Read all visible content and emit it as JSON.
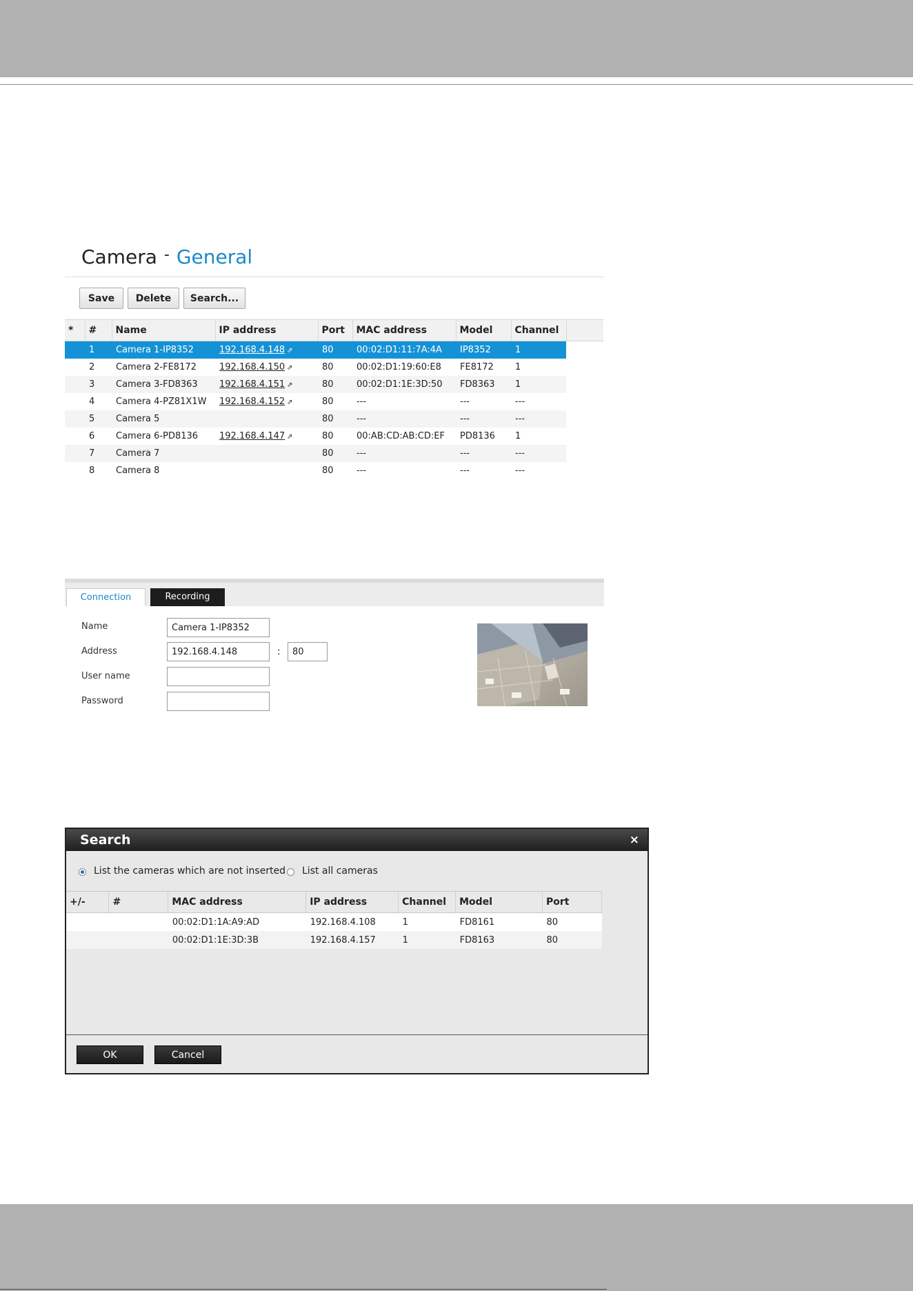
{
  "camera_page": {
    "title": "Camera",
    "separator": "-",
    "subtitle": "General",
    "toolbar": {
      "save_label": "Save",
      "delete_label": "Delete",
      "search_label": "Search..."
    },
    "columns": [
      "*",
      "#",
      "Name",
      "IP address",
      "Port",
      "MAC address",
      "Model",
      "Channel"
    ],
    "rows": [
      {
        "num": "1",
        "name": "Camera 1-IP8352",
        "ip": "192.168.4.148",
        "port": "80",
        "mac": "00:02:D1:11:7A:4A",
        "model": "IP8352",
        "channel": "1",
        "selected": true
      },
      {
        "num": "2",
        "name": "Camera 2-FE8172",
        "ip": "192.168.4.150",
        "port": "80",
        "mac": "00:02:D1:19:60:E8",
        "model": "FE8172",
        "channel": "1"
      },
      {
        "num": "3",
        "name": "Camera 3-FD8363",
        "ip": "192.168.4.151",
        "port": "80",
        "mac": "00:02:D1:1E:3D:50",
        "model": "FD8363",
        "channel": "1"
      },
      {
        "num": "4",
        "name": "Camera 4-PZ81X1W",
        "ip": "192.168.4.152",
        "port": "80",
        "mac": "---",
        "model": "---",
        "channel": "---"
      },
      {
        "num": "5",
        "name": "Camera 5",
        "ip": "",
        "port": "80",
        "mac": "---",
        "model": "---",
        "channel": "---"
      },
      {
        "num": "6",
        "name": "Camera 6-PD8136",
        "ip": "192.168.4.147",
        "port": "80",
        "mac": "00:AB:CD:AB:CD:EF",
        "model": "PD8136",
        "channel": "1"
      },
      {
        "num": "7",
        "name": "Camera 7",
        "ip": "",
        "port": "80",
        "mac": "---",
        "model": "---",
        "channel": "---"
      },
      {
        "num": "8",
        "name": "Camera 8",
        "ip": "",
        "port": "80",
        "mac": "---",
        "model": "---",
        "channel": "---"
      }
    ]
  },
  "tabs": {
    "connection_label": "Connection",
    "recording_label": "Recording"
  },
  "connection_form": {
    "name_label": "Name",
    "name_value": "Camera 1-IP8352",
    "address_label": "Address",
    "address_value": "192.168.4.148",
    "port_separator": ":",
    "port_value": "80",
    "username_label": "User name",
    "username_value": "",
    "password_label": "Password",
    "password_value": ""
  },
  "search_dialog": {
    "title": "Search",
    "close_glyph": "×",
    "option_not_inserted": "List the cameras which are not inserted",
    "option_all": "List all cameras",
    "selected_option": "not_inserted",
    "columns": [
      "+/-",
      "#",
      "MAC address",
      "IP address",
      "Channel",
      "Model",
      "Port"
    ],
    "rows": [
      {
        "plusminus": "",
        "num": "",
        "mac": "00:02:D1:1A:A9:AD",
        "ip": "192.168.4.108",
        "channel": "1",
        "model": "FD8161",
        "port": "80"
      },
      {
        "plusminus": "",
        "num": "",
        "mac": "00:02:D1:1E:3D:3B",
        "ip": "192.168.4.157",
        "channel": "1",
        "model": "FD8163",
        "port": "80"
      }
    ],
    "ok_label": "OK",
    "cancel_label": "Cancel"
  },
  "colors": {
    "accent": "#1a8ac8",
    "selected_row": "#1592d6",
    "header_band": "#b1b1b1",
    "dialog_header": "#1f1f1f"
  },
  "icons": {
    "external_link": "external-link-icon",
    "close": "close-icon"
  }
}
